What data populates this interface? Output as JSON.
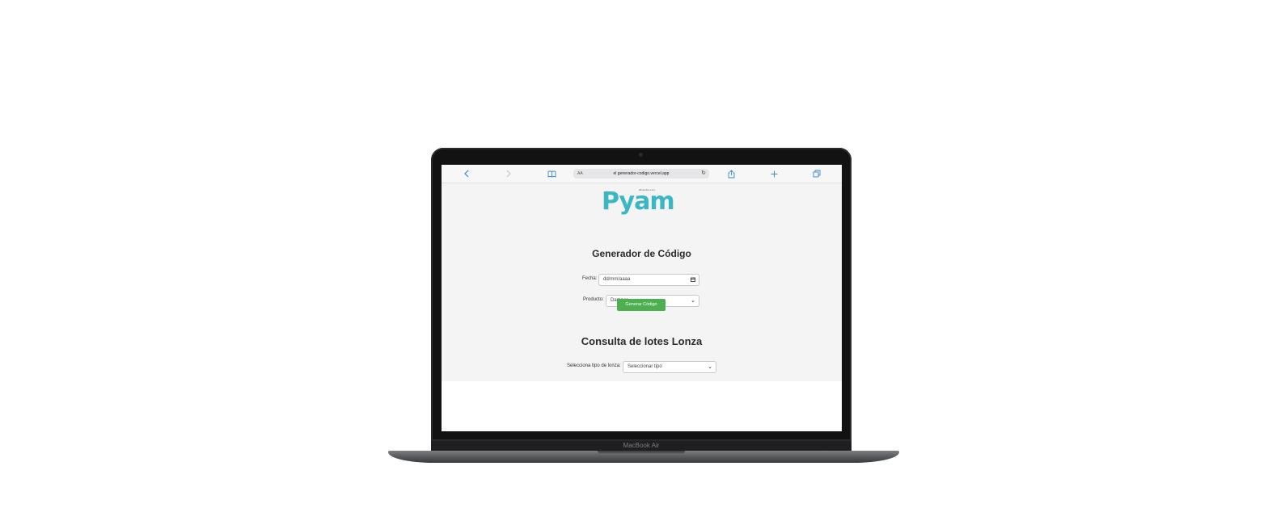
{
  "device": {
    "model_label": "MacBook Air"
  },
  "browser": {
    "address_bar": {
      "text_size_button": "AA",
      "url": "el generador-codigo.vercel.app",
      "reload_icon": "reload-icon"
    },
    "icons": [
      "back-icon",
      "forward-icon",
      "bookmarks-icon",
      "share-icon",
      "new-tab-icon",
      "tabs-icon"
    ]
  },
  "page": {
    "logo": {
      "wordmark": "Pyam",
      "tagline": "alimentos s.a.s"
    },
    "generator": {
      "title": "Generador de Código",
      "date_label": "Fecha:",
      "date_placeholder": "dd/mm/aaaa",
      "product_label": "Producto:",
      "product_selected": "Damper",
      "button_label": "Generar Código"
    },
    "lots": {
      "title": "Consulta de lotes Lonza",
      "type_label": "Selecciona tipo de lonza:",
      "type_selected": "Seleccionar tipo"
    }
  },
  "colors": {
    "brand": "#3bb7c4",
    "button": "#4caf50",
    "browser_accent": "#3a86d4"
  }
}
